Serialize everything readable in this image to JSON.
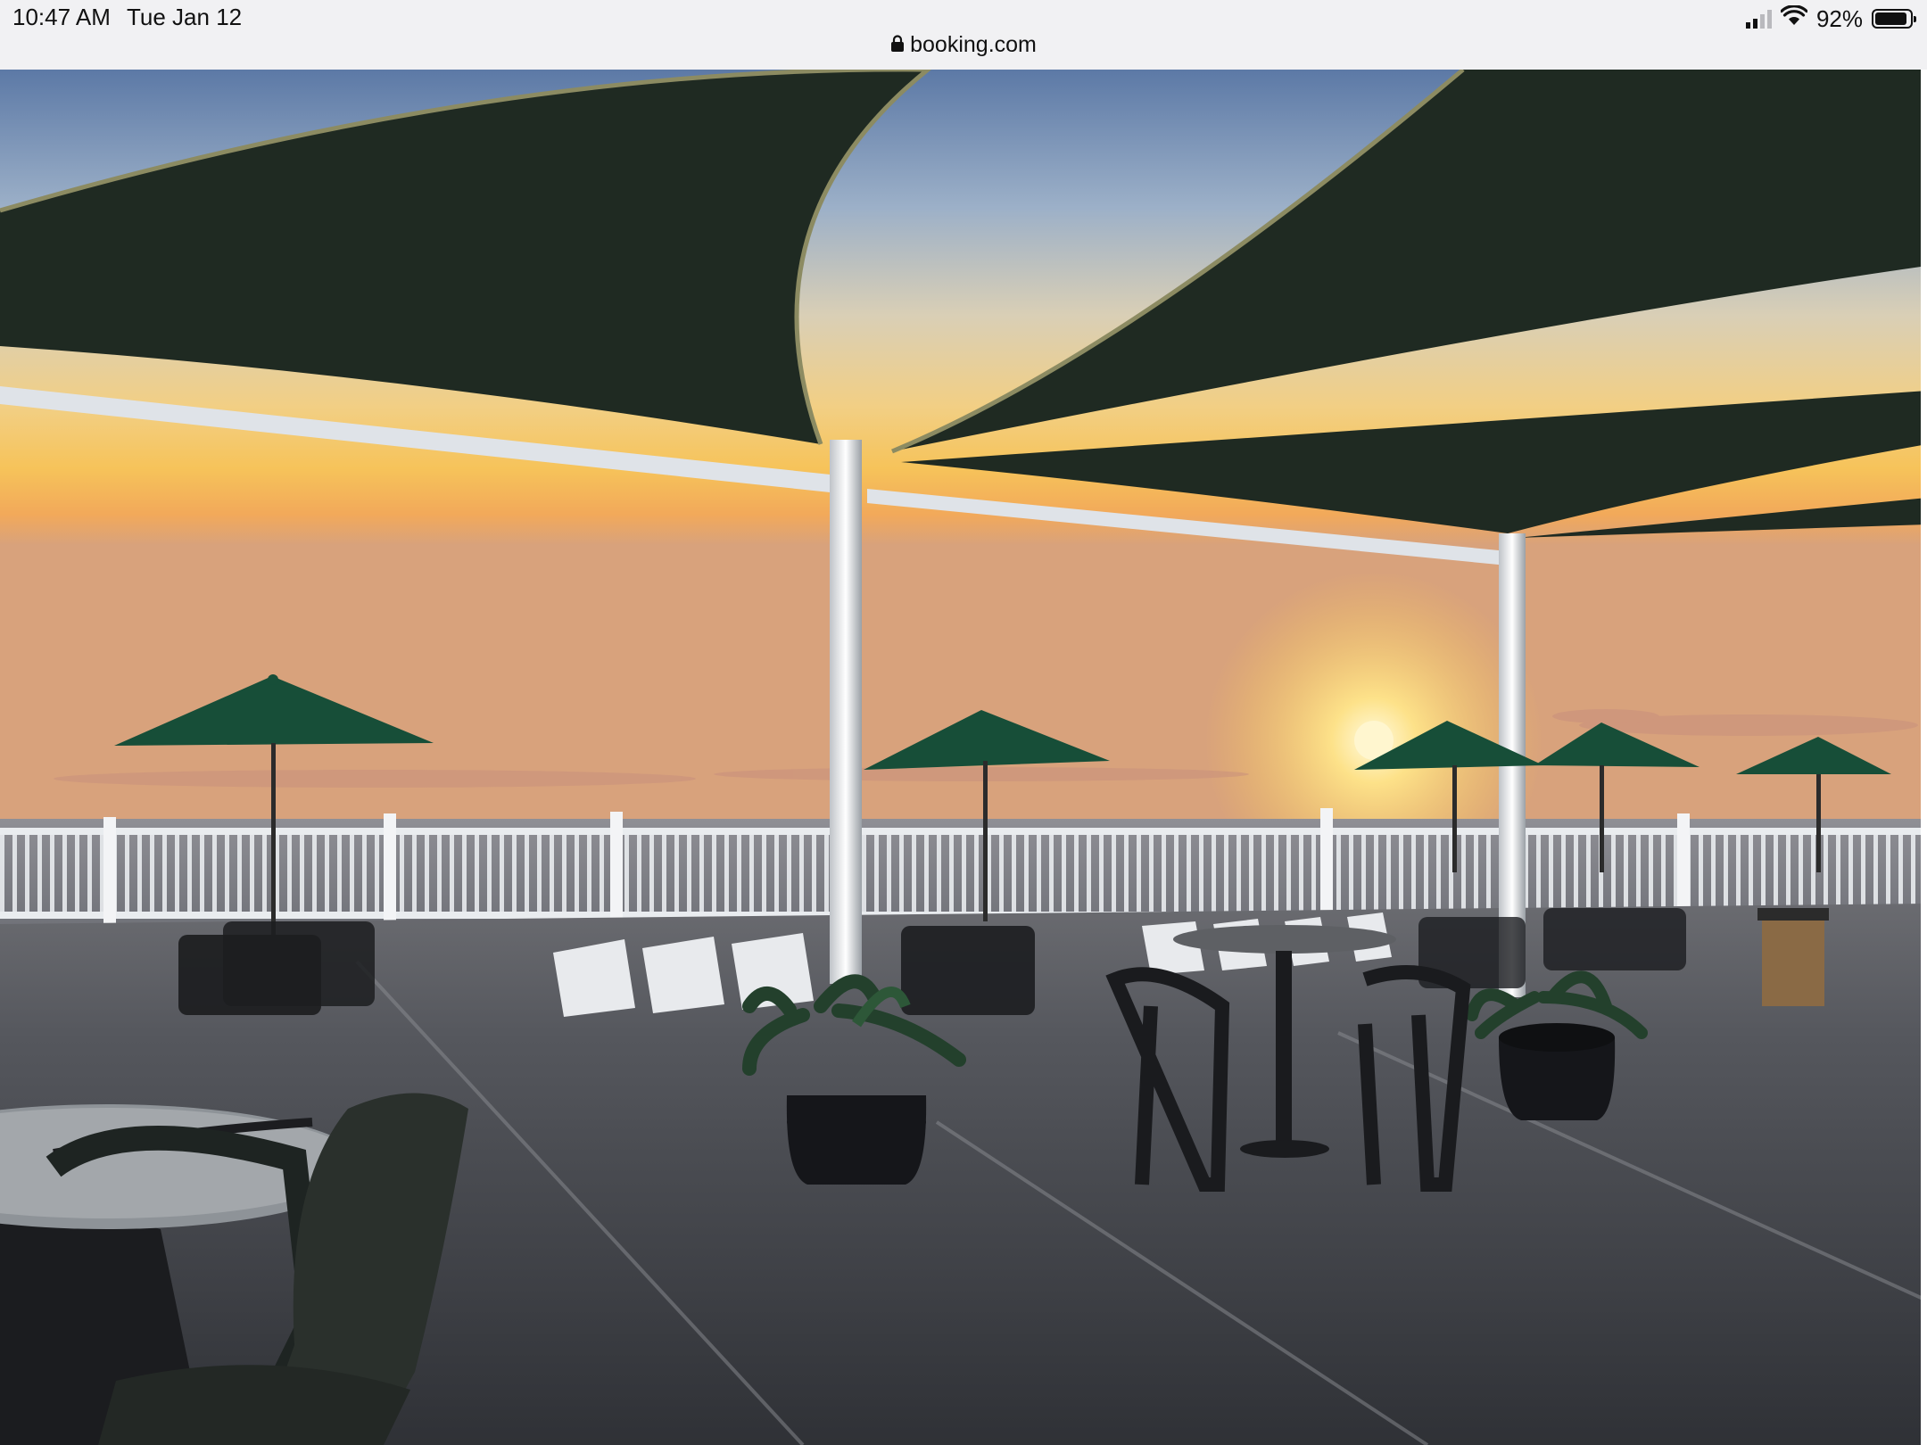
{
  "status_bar": {
    "time": "10:47 AM",
    "date": "Tue Jan 12",
    "url": "booking.com",
    "battery_text": "92%",
    "battery_level": 0.92
  },
  "photo": {
    "icons": [
      "lock-icon",
      "wifi-icon",
      "signal-icon",
      "battery-icon"
    ],
    "colors": {
      "sky_top": "#5d7aa8",
      "sky_horizon": "#f6c35a",
      "sun": "#fff2b0",
      "shade_sail": "#1f2a22",
      "deck": "#4a4c52",
      "rail": "#e9ecef",
      "umbrella": "#174e38"
    }
  }
}
